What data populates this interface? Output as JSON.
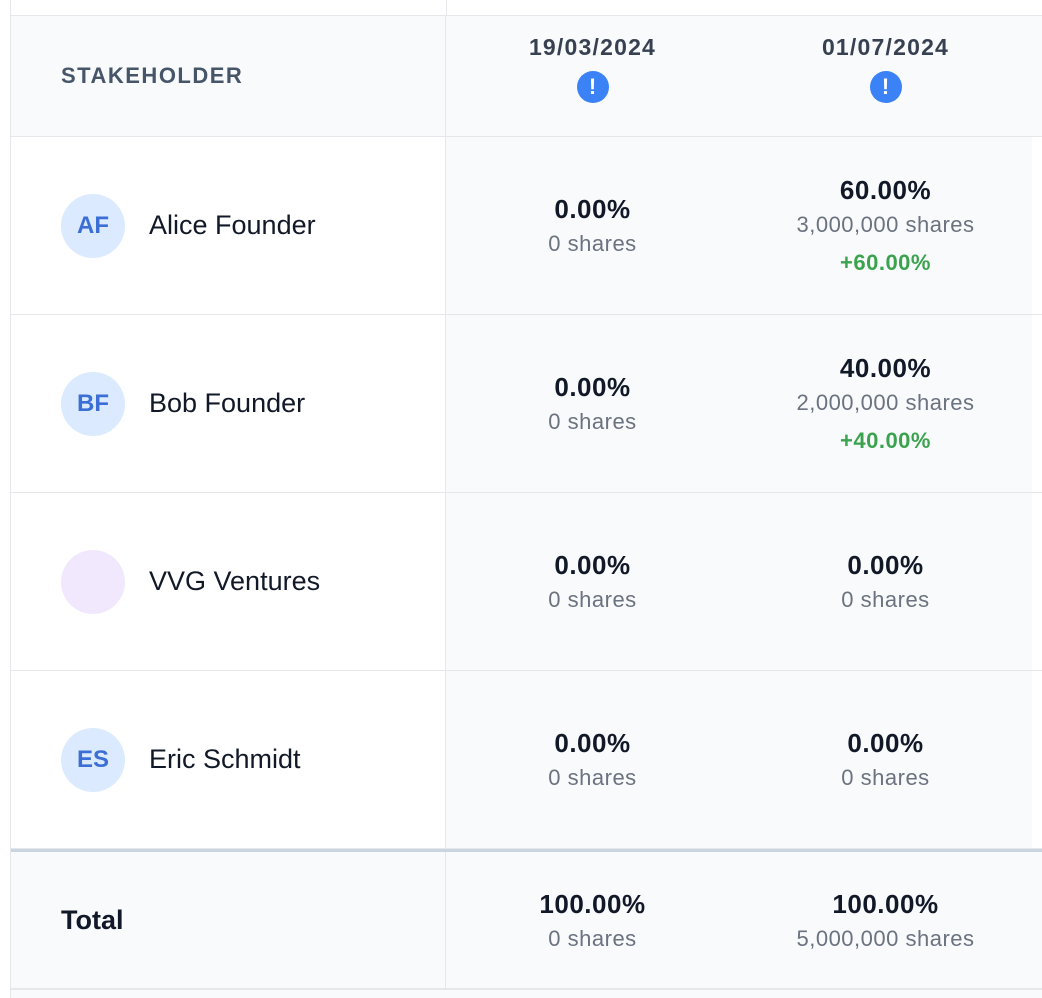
{
  "table": {
    "header": {
      "stakeholder": "STAKEHOLDER",
      "dates": [
        "19/03/2024",
        "01/07/2024"
      ],
      "warning_symbol": "!"
    },
    "rows": [
      {
        "initials": "AF",
        "name": "Alice Founder",
        "cols": [
          {
            "pct": "0.00%",
            "shares": "0 shares",
            "delta": ""
          },
          {
            "pct": "60.00%",
            "shares": "3,000,000 shares",
            "delta": "+60.00%"
          }
        ]
      },
      {
        "initials": "BF",
        "name": "Bob Founder",
        "cols": [
          {
            "pct": "0.00%",
            "shares": "0 shares",
            "delta": ""
          },
          {
            "pct": "40.00%",
            "shares": "2,000,000 shares",
            "delta": "+40.00%"
          }
        ]
      },
      {
        "initials": "",
        "name": "VVG Ventures",
        "cols": [
          {
            "pct": "0.00%",
            "shares": "0 shares",
            "delta": ""
          },
          {
            "pct": "0.00%",
            "shares": "0 shares",
            "delta": ""
          }
        ]
      },
      {
        "initials": "ES",
        "name": "Eric Schmidt",
        "cols": [
          {
            "pct": "0.00%",
            "shares": "0 shares",
            "delta": ""
          },
          {
            "pct": "0.00%",
            "shares": "0 shares",
            "delta": ""
          }
        ]
      }
    ],
    "total": {
      "label": "Total",
      "cols": [
        {
          "pct": "100.00%",
          "shares": "0 shares"
        },
        {
          "pct": "100.00%",
          "shares": "5,000,000 shares"
        }
      ]
    }
  },
  "colors": {
    "accent": "#3b82f6",
    "positive": "#3ba34e",
    "avatar_blue": "#dbeafe",
    "avatar_purple": "#f1e8fd"
  },
  "icons": {
    "warning": "exclamation-circle-icon"
  }
}
